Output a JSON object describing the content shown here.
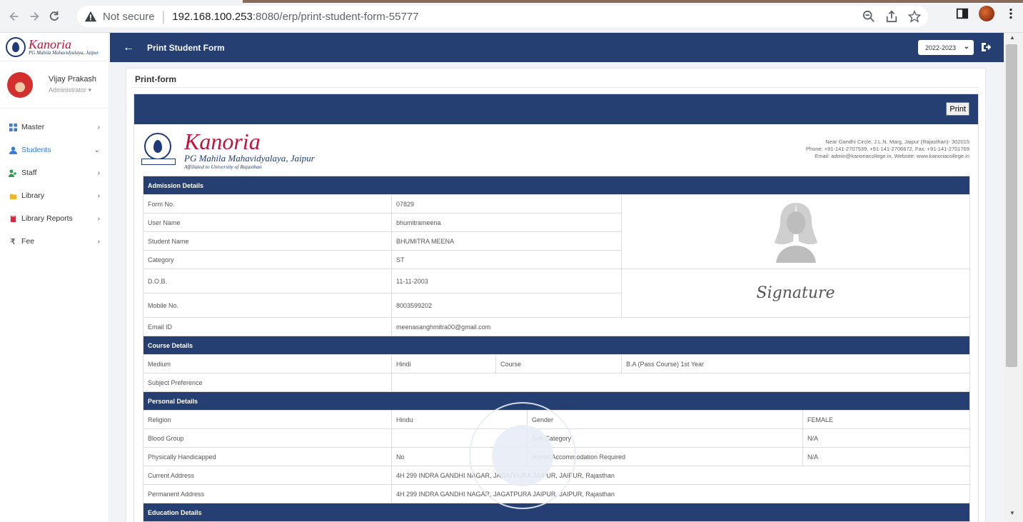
{
  "browser": {
    "not_secure": "Not secure",
    "host": "192.168.100.253",
    "path": ":8080/erp/print-student-form-55777"
  },
  "sidebar": {
    "brand_name": "Kanoria",
    "brand_sub": "PG Mahila Mahavidyalaya, Jaipur",
    "user_name": "Vijay Prakash",
    "user_role": "Administrator ▾",
    "items": [
      {
        "label": "Master",
        "icon": "grid-icon",
        "chevron": "›"
      },
      {
        "label": "Students",
        "icon": "user-icon",
        "chevron": "⌄",
        "active": true
      },
      {
        "label": "Staff",
        "icon": "users-icon",
        "chevron": "›"
      },
      {
        "label": "Library",
        "icon": "folder-icon",
        "chevron": "›"
      },
      {
        "label": "Library Reports",
        "icon": "book-icon",
        "chevron": "›"
      },
      {
        "label": "Fee",
        "icon": "rupee-icon",
        "chevron": "›"
      }
    ]
  },
  "header": {
    "back": "←",
    "title": "Print Student Form",
    "year": "2022-2023"
  },
  "card": {
    "title": "Print-form",
    "print_label": "Print"
  },
  "letterhead": {
    "name": "Kanoria",
    "sub": "PG Mahila Mahavidyalaya, Jaipur",
    "affiliation": "Affiliated to University of Rajasthan",
    "address": "Near Gandhi Circle, J.L.N. Marg, Jaipur (Rajasthan)- 302015",
    "phone": "Phone: +91-141-2707539, +91-141-2706672, Fax: +91-141-2701769",
    "email": "Email: admin@kanoriacollege.in, Website: www.kanoriacollege.in"
  },
  "form": {
    "admission_title": "Admission Details",
    "form_no_label": "Form No.",
    "form_no": "07829",
    "user_name_label": "User Name",
    "user_name": "bhumitrameena",
    "student_name_label": "Student Name",
    "student_name": "BHUMITRA MEENA",
    "category_label": "Category",
    "category": "ST",
    "dob_label": "D.O.B.",
    "dob": "11-11-2003",
    "mobile_label": "Mobile No.",
    "mobile": "8003599202",
    "email_label": "Email ID",
    "email": "meenasanghmitra00@gmail.com",
    "signature": "Signature",
    "course_title": "Course Details",
    "medium_label": "Medium",
    "medium": "Hindi",
    "course_label": "Course",
    "course": "B.A (Pass Course) 1st Year",
    "subject_pref_label": "Subject Preference",
    "subject_pref": "",
    "personal_title": "Personal Details",
    "religion_label": "Religion",
    "religion": "Hindu",
    "gender_label": "Gender",
    "gender": "FEMALE",
    "blood_label": "Blood Group",
    "blood": "",
    "subcat_label": "Sub Category",
    "subcat": "N/A",
    "ph_label": "Physically Handicapped",
    "ph": "No",
    "hostel_label": "Hostel Accommodation Required",
    "hostel": "N/A",
    "cur_addr_label": "Current Address",
    "cur_addr": "4H 299 INDRA GANDHI NAGAR, JAGATPURA JAIPUR, JAIPUR, Rajasthan",
    "perm_addr_label": "Permanent Address",
    "perm_addr": "4H 299 INDRA GANDHI NAGAR, JAGATPURA JAIPUR, JAIPUR, Rajasthan",
    "education_title": "Education Details"
  },
  "colors": {
    "navy": "#253f73",
    "brand_red": "#c0143c"
  }
}
